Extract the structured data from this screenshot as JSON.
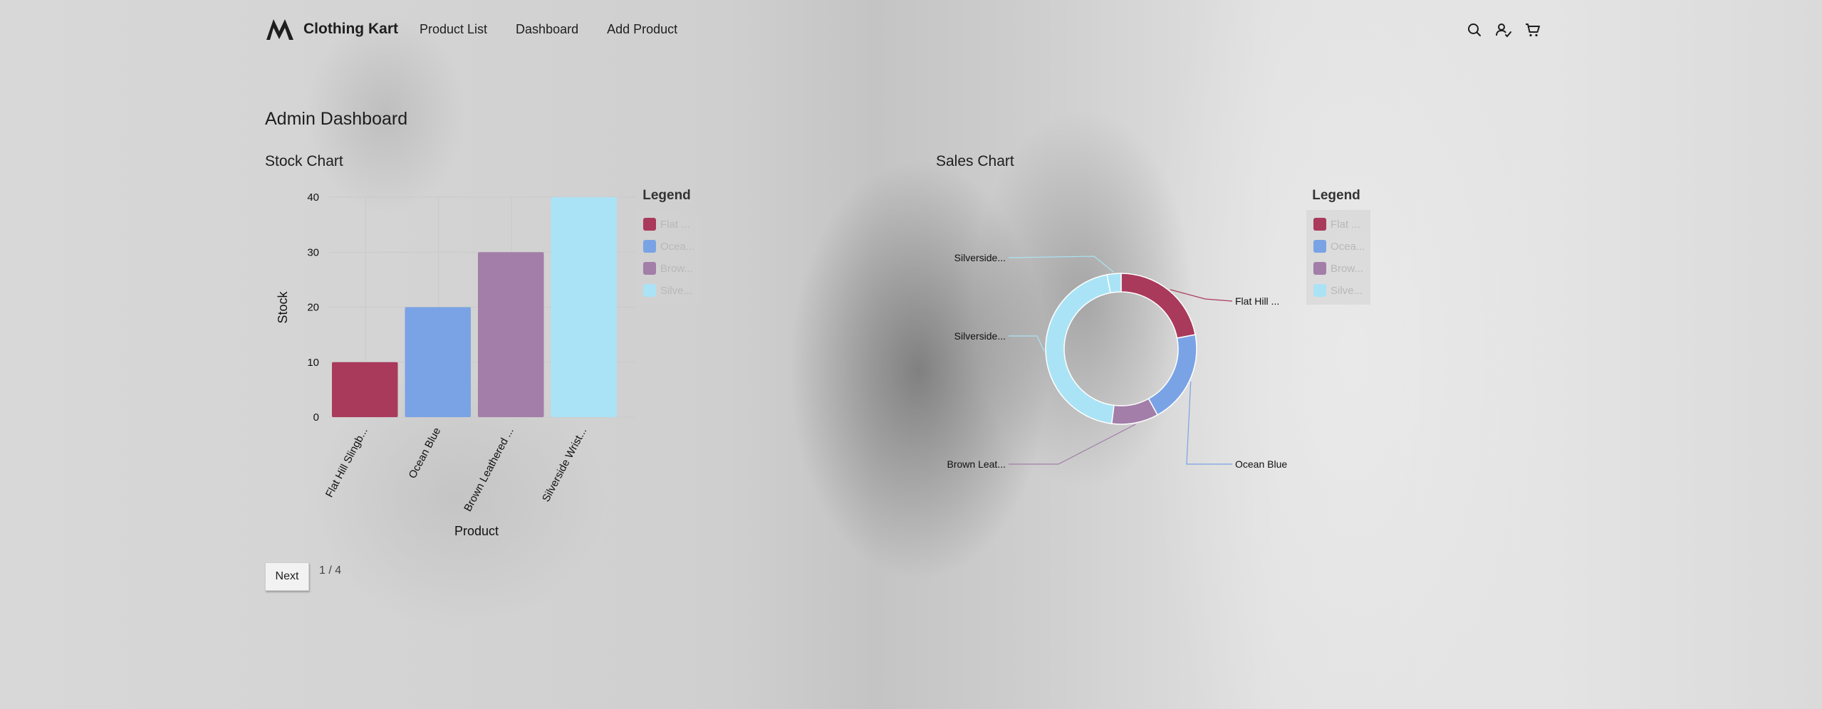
{
  "app": {
    "brand_name": "Clothing Kart",
    "nav_links": [
      "Product List",
      "Dashboard",
      "Add Product"
    ],
    "nav_icons": [
      "search-icon",
      "user-check-icon",
      "cart-icon"
    ]
  },
  "page_title": "Admin Dashboard",
  "stock_section": {
    "title": "Stock Chart"
  },
  "sales_section": {
    "title": "Sales Chart"
  },
  "pagination": {
    "next_label": "Next",
    "page_indicator": "1 / 4"
  },
  "colors": {
    "flat_hill": "#a93a5b",
    "ocean_blue": "#7aa3e5",
    "brown_leathered": "#a27ea8",
    "silverside": "#aae3f5"
  },
  "chart_data": [
    {
      "type": "bar",
      "title": "Stock Chart",
      "xlabel": "Product",
      "ylabel": "Stock",
      "categories": [
        "Flat Hill Slingb...",
        "Ocean Blue",
        "Brown Leathered ...",
        "Silverside Wrist..."
      ],
      "values": [
        10,
        20,
        30,
        40
      ],
      "ylim": [
        0,
        40
      ],
      "yticks": [
        0,
        10,
        20,
        30,
        40
      ],
      "grid": true,
      "legend": {
        "title": "Legend",
        "items": [
          "Flat ...",
          "Ocea...",
          "Brow...",
          "Silve..."
        ],
        "placement": "right"
      }
    },
    {
      "type": "pie",
      "title": "Sales Chart",
      "donut": true,
      "slices": [
        {
          "label": "Flat Hill ...",
          "value": 22
        },
        {
          "label": "Ocean Blue",
          "value": 20
        },
        {
          "label": "Brown Leat...",
          "value": 10
        },
        {
          "label": "Silverside...",
          "value": 45
        },
        {
          "label": "Silverside...",
          "value": 3
        }
      ],
      "legend": {
        "title": "Legend",
        "items": [
          "Flat ...",
          "Ocea...",
          "Brow...",
          "Silve..."
        ],
        "placement": "right"
      }
    }
  ]
}
